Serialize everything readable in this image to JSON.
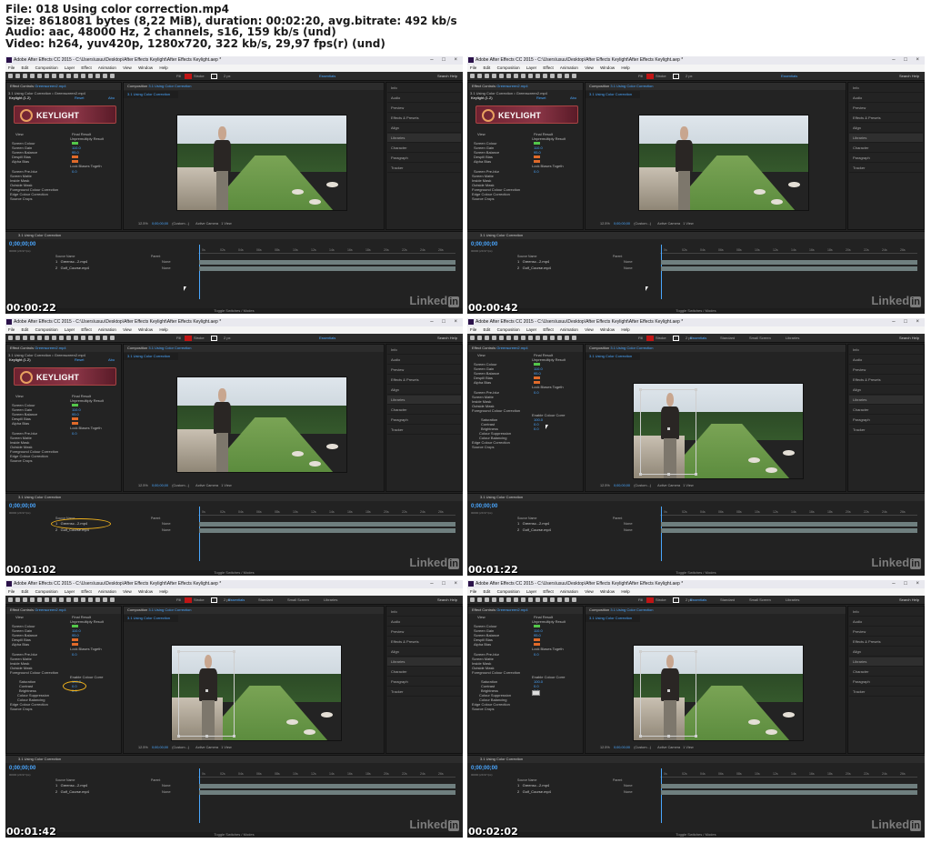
{
  "header": {
    "file_line": "File: 018 Using color correction.mp4",
    "size_line": "Size: 8618081 bytes (8,22 MiB), duration: 00:02:20, avg.bitrate: 492 kb/s",
    "audio_line": "Audio: aac, 48000 Hz, 2 channels, s16, 159 kb/s (und)",
    "video_line": "Video: h264, yuv420p, 1280x720, 322 kb/s, 29,97 fps(r) (und)"
  },
  "ui": {
    "window_title": "Adobe After Effects CC 2015 - C:\\Users\\usuu\\Desktop\\After Effects Keylight\\After Effects Keylight.aep *",
    "menu": [
      "File",
      "Edit",
      "Composition",
      "Layer",
      "Effect",
      "Animation",
      "View",
      "Window",
      "Help"
    ],
    "fill_label": "Fill",
    "stroke_label": "Stroke",
    "px_label": "2 px",
    "workspaces": [
      "Essentials",
      "Standard",
      "Small Screen",
      "Libraries"
    ],
    "search_help": "Search Help",
    "ec_tab": "Effect Controls",
    "ec_layer": "Greenscreen2.mp4",
    "ec_breadcrumb": "3.1 Using Color Correction • Greenscreen2.mp4",
    "fx_name": "Keylight (1.2)",
    "fx_reset": "Reset",
    "fx_about": "Abo",
    "keylight_logo": "KEYLIGHT",
    "view_label": "View",
    "view_value": "Final Result",
    "unpremult": "Unpremultiply Result",
    "screen_colour": "Screen Colour",
    "screen_gain": "Screen Gain",
    "screen_gain_val": "110.0",
    "screen_balance": "Screen Balance",
    "screen_balance_val": "95.0",
    "despill_bias": "Despill Bias",
    "alpha_bias": "Alpha Bias",
    "lock_biases": "Lock Biases Togeth",
    "screen_preblur": "Screen Pre-blur",
    "preblur_val": "0.0",
    "screen_matte": "Screen Matte",
    "inside_mask": "Inside Mask",
    "outside_mask": "Outside Mask",
    "fg_colour_correction": "Foreground Colour Correction",
    "edge_colour_correction": "Edge Colour Correction",
    "source_crops": "Source Crops",
    "enable_colour_corr": "Enable Colour Corre",
    "saturation": "Saturation",
    "saturation_val": "100.0",
    "contrast": "Contrast",
    "contrast_val": "0.0",
    "brightness": "Brightness",
    "brightness_val": "0.0",
    "colour_suppression": "Colour Suppression",
    "colour_balancing": "Colour Balancing",
    "comp_tab": "Composition",
    "comp_name": "3.1 Using Color Correction",
    "zoom": "12.5%",
    "timecode_small": "0;00;00;00",
    "resolution": "(Custom...)",
    "active_camera": "Active Camera",
    "view_count": "1 View",
    "right_panel": [
      "Info",
      "Audio",
      "Preview",
      "Effects & Presets",
      "Align",
      "Libraries",
      "Character",
      "Paragraph",
      "Tracker"
    ],
    "timeline_tab": "3.1 Using Color Correction",
    "timecode": "0;00;00;00",
    "fps_line": "00000 (29.97 fps)",
    "source_name_col": "Source Name",
    "parent_col": "Parent",
    "layers": [
      {
        "index": "1",
        "name": "Greensc...2.mp4",
        "parent": "None"
      },
      {
        "index": "2",
        "name": "Golf_Course.mp4",
        "parent": "None"
      }
    ],
    "ruler_ticks": [
      "0s",
      "02s",
      "04s",
      "06s",
      "08s",
      "10s",
      "12s",
      "14s",
      "16s",
      "18s",
      "20s",
      "22s",
      "24s",
      "26s"
    ],
    "toggle_switches": "Toggle Switches / Modes",
    "linkedin": "Linked",
    "linkedin_in": "in"
  },
  "frames": [
    {
      "timestamp": "00:00:22",
      "workspace_variant": "a",
      "ec_variant": "keylight"
    },
    {
      "timestamp": "00:00:42",
      "workspace_variant": "a",
      "ec_variant": "keylight"
    },
    {
      "timestamp": "00:01:02",
      "workspace_variant": "a",
      "ec_variant": "keylight"
    },
    {
      "timestamp": "00:01:22",
      "workspace_variant": "b",
      "ec_variant": "fgcc"
    },
    {
      "timestamp": "00:01:42",
      "workspace_variant": "b",
      "ec_variant": "fgcc"
    },
    {
      "timestamp": "00:02:02",
      "workspace_variant": "b",
      "ec_variant": "fgcc"
    }
  ],
  "colors": {
    "accent": "#4aa7ff",
    "keylight_red": "#8a3546",
    "screen_green": "#53c64a",
    "despill_orange": "#e06a2a",
    "annotation_ring": "#f0b21d"
  }
}
